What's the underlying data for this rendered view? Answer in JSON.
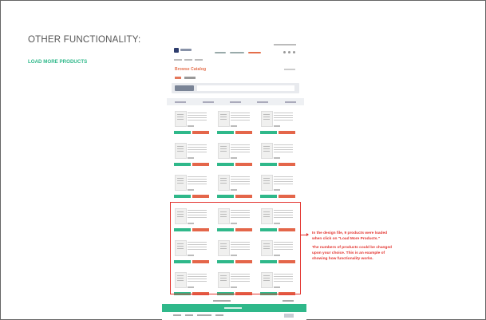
{
  "slide": {
    "heading": "OTHER FUNCTIONALITY:",
    "subheading": "LOAD MORE PRODUCTS"
  },
  "mockup": {
    "page_title": "Browse Catalog",
    "initial_rows": 3,
    "loaded_rows": 3,
    "columns": 3
  },
  "annotation": {
    "line1": "In the design file, 9 products were loaded when click on \"Load More Products.\"",
    "line2": "The numbers of products could be changed upon your choice. This is an example of showing how functionality works."
  },
  "colors": {
    "accent_green": "#2fb88a",
    "accent_orange": "#e4664a",
    "highlight_red": "#e3342f"
  },
  "icons": [
    "arrow-right-icon"
  ]
}
